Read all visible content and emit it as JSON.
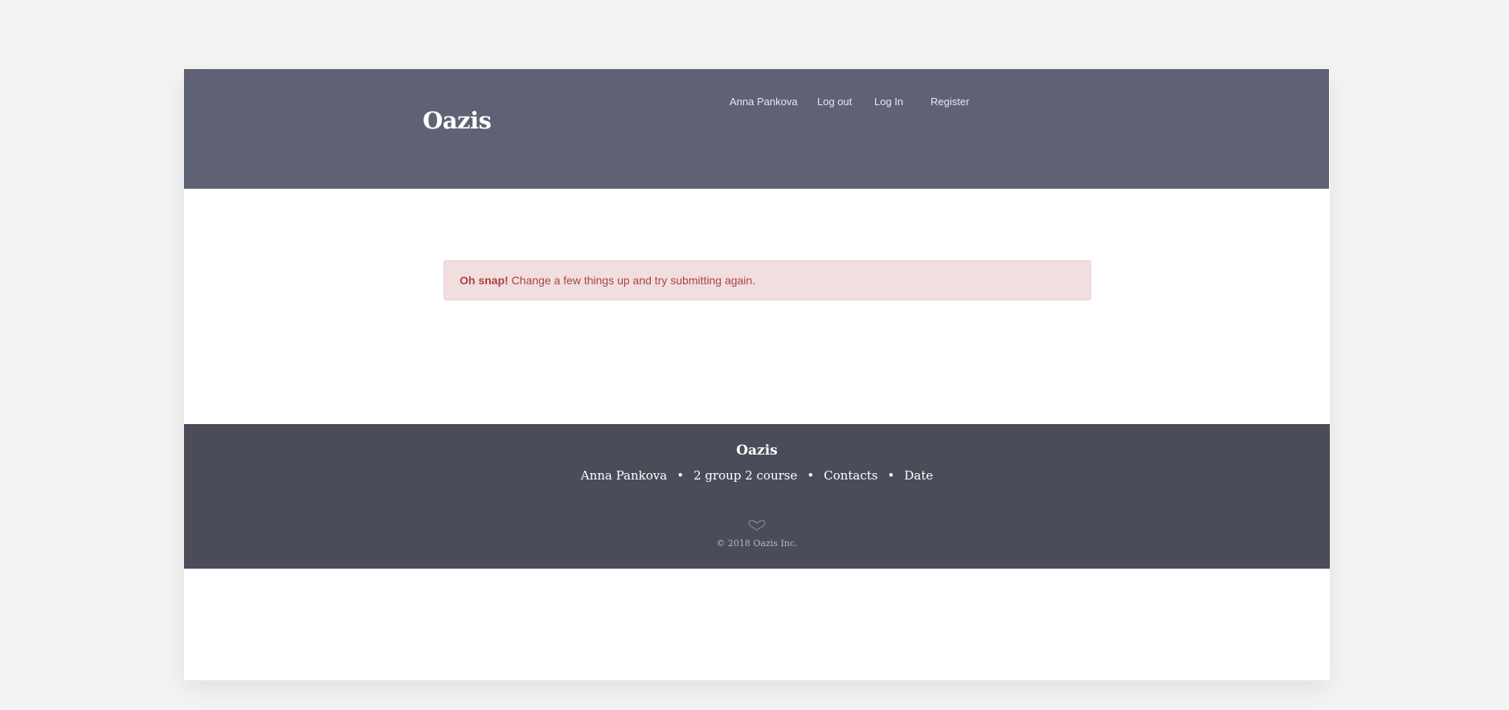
{
  "header": {
    "brand": "Oazis",
    "nav": {
      "user": "Anna Pankova",
      "logout": "Log out",
      "login": "Log In",
      "register": "Register"
    }
  },
  "alert": {
    "strong": "Oh snap!",
    "message": " Change a few things up and try submitting again."
  },
  "footer": {
    "brand": "Oazis",
    "links": [
      "Anna Pankova",
      "2 group 2 course",
      "Contacts",
      "Date"
    ],
    "separator": "•",
    "copyright": "© 2018 Oazis Inc."
  },
  "colors": {
    "page_bg": "#f3f3f3",
    "header_bg": "#5f6274",
    "footer_bg": "#4a4c5a",
    "alert_bg": "#f2dede",
    "alert_text": "#a94442"
  },
  "icons": {
    "footer_ornament": "heart-icon"
  }
}
